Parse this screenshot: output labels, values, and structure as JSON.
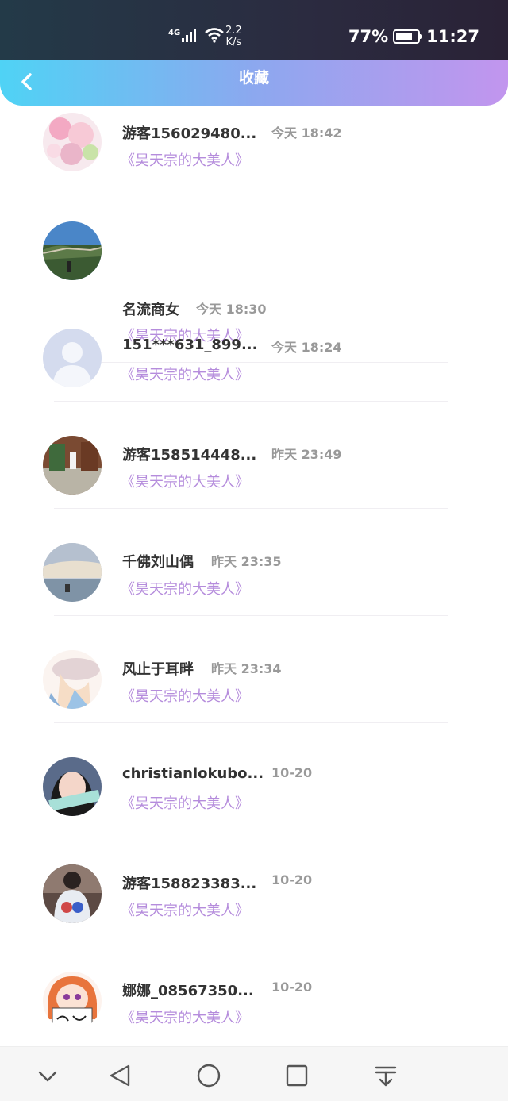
{
  "status_bar": {
    "network": "4G",
    "speed_value": "2.2",
    "speed_unit": "K/s",
    "battery": "77%",
    "battery_level": 0.77,
    "time": "11:27"
  },
  "header": {
    "title": "收藏",
    "back_icon": "chevron-left-icon"
  },
  "colors": {
    "header_gradient_start": "#4fd3f5",
    "header_gradient_end": "#c295ee",
    "book_title": "#b58cdc",
    "name": "#333333",
    "time": "#999999"
  },
  "favorites": [
    {
      "name": "游客156029480...",
      "time": "今天 18:42",
      "book": "《昊天宗的大美人》",
      "avatar": "pink-flowers"
    },
    {
      "name": "名流商女",
      "time": "今天 18:30",
      "book": "《昊天宗的大美人》",
      "avatar": "great-wall"
    },
    {
      "name": "151***631_899...",
      "time": "今天 18:24",
      "book": "《昊天宗的大美人》",
      "avatar": "default-user"
    },
    {
      "name": "游客158514448...",
      "time": "昨天 23:49",
      "book": "《昊天宗的大美人》",
      "avatar": "plaza"
    },
    {
      "name": "千佛刘山偶",
      "time": "昨天 23:35",
      "book": "《昊天宗的大美人》",
      "avatar": "lake"
    },
    {
      "name": "风止于耳畔",
      "time": "昨天 23:34",
      "book": "《昊天宗的大美人》",
      "avatar": "anime-hat"
    },
    {
      "name": "christianlokubo...",
      "time": "10-20",
      "book": "《昊天宗的大美人》",
      "avatar": "girl-photo"
    },
    {
      "name": "游客158823383...",
      "time": "10-20",
      "book": "《昊天宗的大美人》",
      "avatar": "hoodie"
    },
    {
      "name": "娜娜_08567350...",
      "time": "10-20",
      "book": "《昊天宗的大美人》",
      "avatar": "anime-sign"
    }
  ],
  "nav_bar": {
    "buttons": [
      "chevron-down-icon",
      "back-triangle-icon",
      "home-circle-icon",
      "recents-square-icon",
      "download-icon"
    ]
  }
}
